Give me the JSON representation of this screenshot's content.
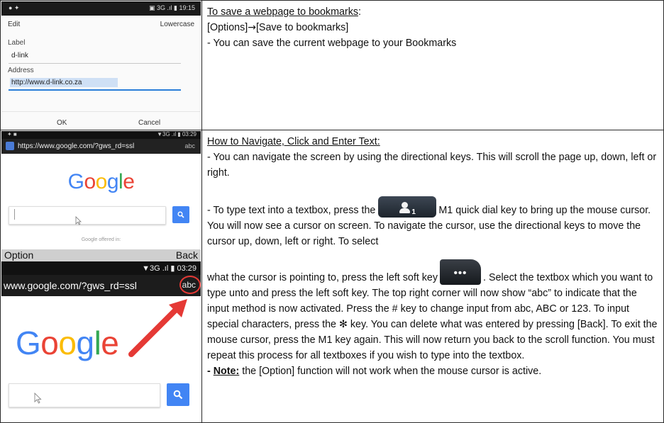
{
  "row1": {
    "phone": {
      "status_left": "● ✦",
      "status_right": "▣ 3G .ıl ▮ 19:15",
      "title": "Edit",
      "title_right": "Lowercase",
      "label_caption": "Label",
      "label_value": "d-link",
      "address_caption": "Address",
      "address_value": "http://www.d-link.co.za",
      "ok": "OK",
      "cancel": "Cancel"
    },
    "heading": "To save a webpage to bookmarks",
    "heading_colon": ":",
    "options_part": "[Options]",
    "arrow": "→",
    "bookmarks_part": "[Save to bookmarks]",
    "desc": "- You can save the current webpage to your Bookmarks"
  },
  "row2": {
    "phone_small": {
      "status_left": "✦ ■",
      "status_right": "▼3G .ıl ▮ 03:29",
      "url": "https://www.google.com/?gws_rd=ssl",
      "abc": "abc",
      "logo": [
        "G",
        "o",
        "o",
        "g",
        "l",
        "e"
      ],
      "offered": "Google offered in:"
    },
    "phone_large": {
      "option": "Option",
      "back": "Back",
      "status_right": "▼3G .ıl ▮ 03:29",
      "url": "www.google.com/?gws_rd=ssl",
      "abc": "abc",
      "logo": [
        "G",
        "o",
        "o",
        "g",
        "l",
        "e"
      ]
    },
    "heading": "How to Navigate, Click and Enter Text:",
    "p1": "- You can navigate the screen by using the directional keys. This will scroll the page up, down, left or right.",
    "p2a": "- To type text into a textbox, press the",
    "m1_key_label": "1",
    "p2b": "M1 quick dial key to bring up the mouse cursor. You will now see a cursor on screen. To navigate the cursor, use the directional keys to move the cursor up, down, left or right. To select",
    "p3a": "what the cursor is pointing to, press the left soft key",
    "soft_key_label": "•••",
    "p3b": ". Select the textbox which you want to type unto and press the left soft key. The top right corner will now show “abc” to indicate that the input method is now activated. Press the # key to change input from abc, ABC or 123. To input special characters, press the ✻ key. You can delete what was entered by pressing [Back]. To exit the mouse cursor, press the M1 key again. This will now return you back to the scroll function. You must repeat this process for all textboxes if you wish to type into the textbox.",
    "note_dash": "- ",
    "note_label": "Note:",
    "note_text": " the [Option] function will not work when the mouse cursor is active.",
    "colors": {
      "google_blue": "#4285F4",
      "google_red": "#EA4335",
      "google_yellow": "#FBBC05",
      "google_green": "#34A853",
      "highlight_red": "#E53935"
    }
  }
}
